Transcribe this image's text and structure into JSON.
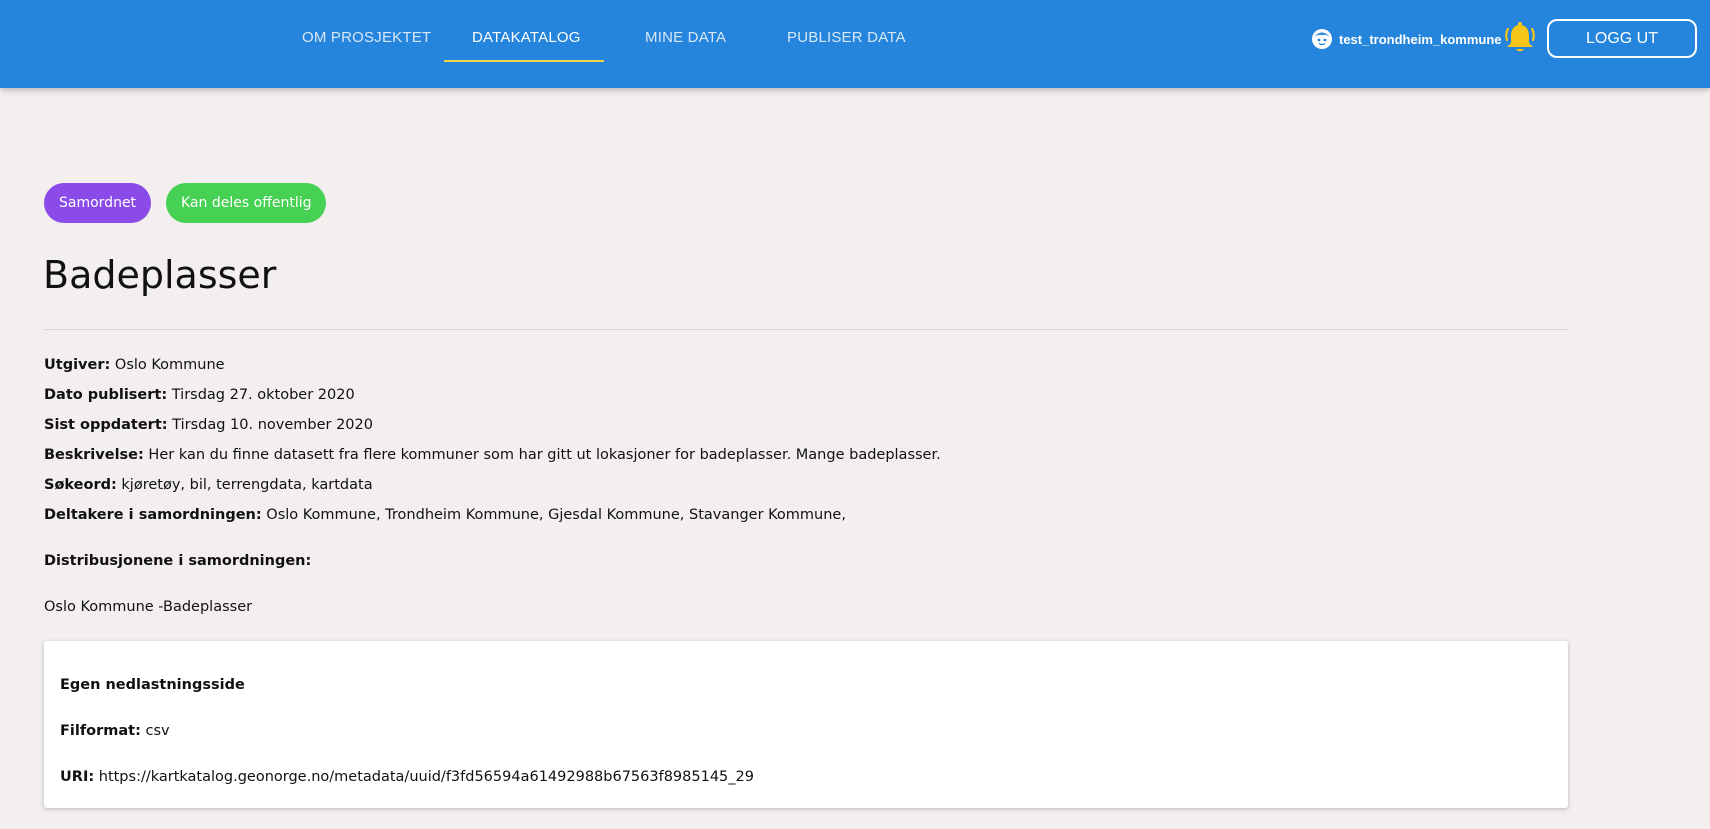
{
  "nav": {
    "items": [
      {
        "label": "OM PROSJEKTET"
      },
      {
        "label": "DATAKATALOG"
      },
      {
        "label": "MINE DATA"
      },
      {
        "label": "PUBLISER DATA"
      }
    ],
    "active": "DATAKATALOG"
  },
  "user": {
    "name": "test_trondheim_kommune",
    "icon": "user-face-icon"
  },
  "notifications": {
    "icon": "bell-icon",
    "color": "#f5c518"
  },
  "logout_label": "LOGG UT",
  "colors": {
    "header": "#2584dc",
    "tag_samordnet": "#8b4be8",
    "tag_public": "#47d154",
    "background": "#f3efef"
  },
  "tags": [
    {
      "label": "Samordnet"
    },
    {
      "label": "Kan deles offentlig"
    }
  ],
  "dataset": {
    "title": "Badeplasser",
    "fields": [
      {
        "label": "Utgiver:",
        "value": "Oslo Kommune"
      },
      {
        "label": "Dato publisert:",
        "value": "Tirsdag 27. oktober 2020"
      },
      {
        "label": "Sist oppdatert:",
        "value": "Tirsdag 10. november 2020"
      },
      {
        "label": "Beskrivelse:",
        "value": "Her kan du finne datasett fra flere kommuner som har gitt ut lokasjoner for badeplasser. Mange badeplasser."
      },
      {
        "label": "Søkeord:",
        "value": "kjøretøy, bil, terrengdata, kartdata"
      },
      {
        "label": "Deltakere i samordningen:",
        "value": "Oslo Kommune, Trondheim Kommune, Gjesdal Kommune, Stavanger Kommune,"
      }
    ],
    "distributions_heading": "Distribusjonene i samordningen:",
    "distribution_owner": "Oslo Kommune -Badeplasser"
  },
  "distribution_card": {
    "title": "Egen nedlastningsside",
    "format_label": "Filformat:",
    "format_value": "csv",
    "uri_label": "URI:",
    "uri_value": "https://kartkatalog.geonorge.no/metadata/uuid/f3fd56594a61492988b67563f8985145_29"
  }
}
